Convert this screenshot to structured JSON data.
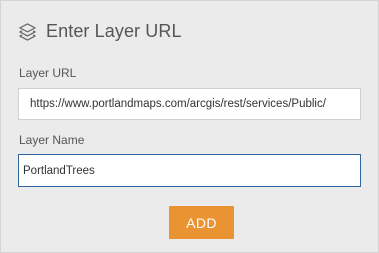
{
  "header": {
    "title": "Enter Layer URL",
    "icon": "layers-icon"
  },
  "form": {
    "url_label": "Layer URL",
    "url_value": "https://www.portlandmaps.com/arcgis/rest/services/Public/",
    "name_label": "Layer Name",
    "name_value": "PortlandTrees"
  },
  "actions": {
    "add_label": "ADD"
  },
  "colors": {
    "background": "#ebebeb",
    "accent_button": "#ea9333",
    "focus_border": "#31669d",
    "text": "#555555"
  }
}
